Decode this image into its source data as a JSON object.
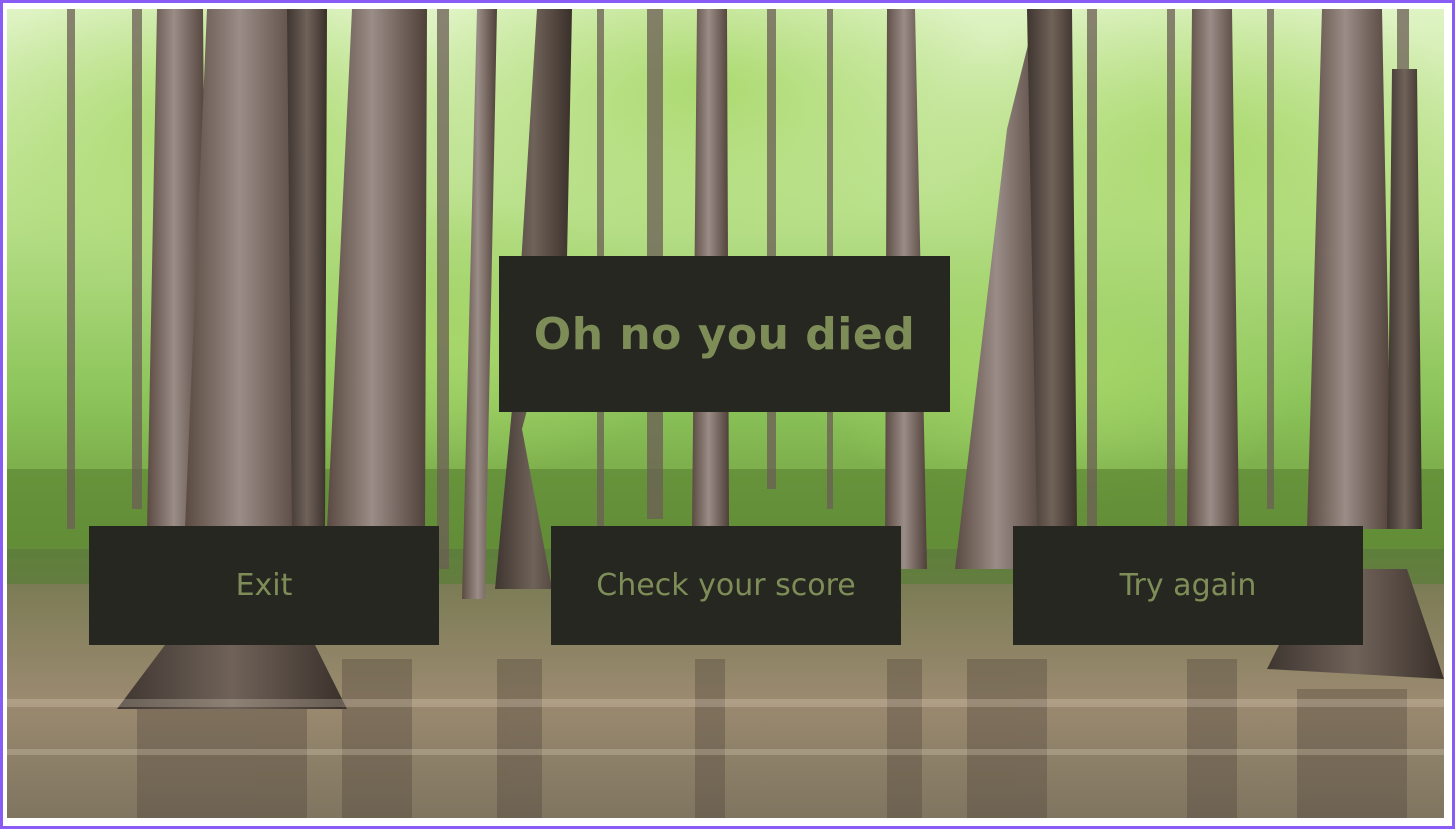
{
  "scene": {
    "background": "cypress-swamp-forest-photo"
  },
  "title": "Oh no you died",
  "buttons": {
    "exit": "Exit",
    "score": "Check your score",
    "retry": "Try again"
  },
  "colors": {
    "frame": "#8a5cf6",
    "panel": "#262720",
    "text": "#7e8d58"
  }
}
